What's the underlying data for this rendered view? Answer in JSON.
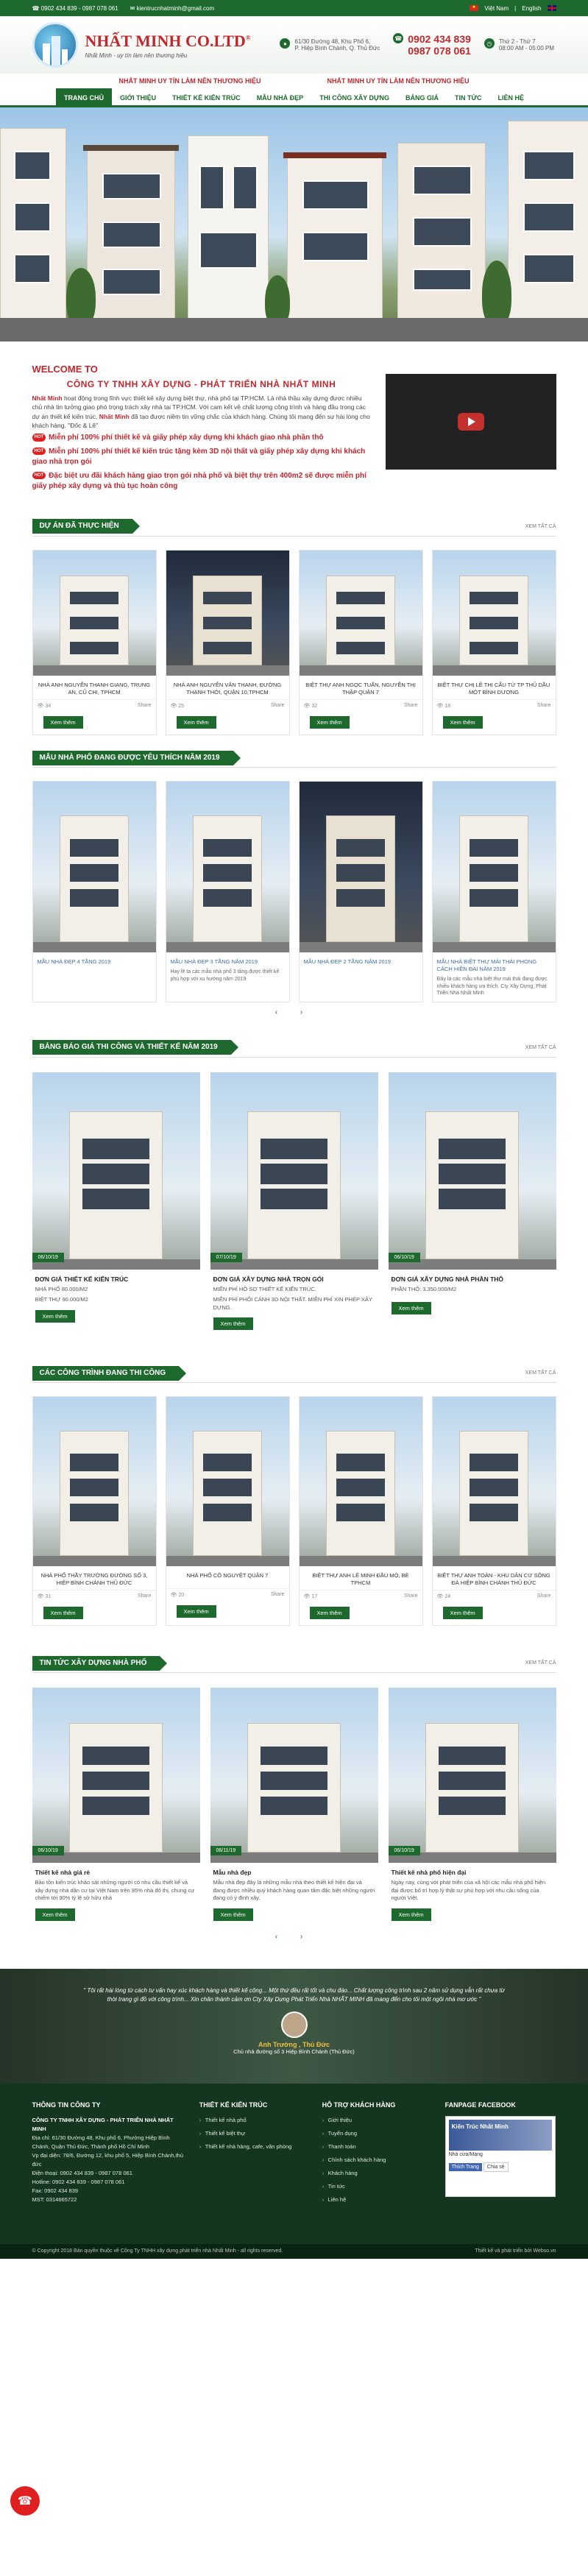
{
  "topbar": {
    "phone": "0902 434 839 - 0987 078 061",
    "email": "kientrucnhatminh@gmail.com",
    "lang_vn": "Việt Nam",
    "lang_en": "English"
  },
  "header": {
    "brand": "NHẤT MINH CO.LTD",
    "reg": "®",
    "slogan": "Nhất Minh - uy tín làm nên thương hiệu",
    "addr1": "61/30 Đường 48, Khu Phố 6,",
    "addr2": "P. Hiệp Bình Chánh, Q. Thủ Đức",
    "phone1": "0902 434 839",
    "phone2": "0987 078 061",
    "hours1": "Thứ 2 - Thứ 7",
    "hours2": "08:00 AM - 05:00 PM"
  },
  "marquee": [
    "NHẤT MINH UY TÍN LÀM NÊN THƯƠNG HIỆU",
    "NHẤT MINH UY TÍN LÀM NÊN THƯƠNG HIỆU"
  ],
  "nav": [
    "TRANG CHỦ",
    "GIỚI THIỆU",
    "THIẾT KẾ KIẾN TRÚC",
    "MẪU NHÀ ĐẸP",
    "THI CÔNG XÂY DỰNG",
    "BẢNG GIÁ",
    "TIN TỨC",
    "LIÊN HỆ"
  ],
  "welcome": {
    "title": "WELCOME TO",
    "company": "CÔNG TY TNHH XÂY DỰNG - PHÁT TRIỂN NHÀ NHẤT MINH",
    "p1a": "Nhất Minh",
    "p1b": " hoạt động trong lĩnh vực thiết kế xây dựng biệt thự, nhà phố tại TP.HCM. Là nhà thầu xây dựng được nhiều chủ nhà tin tưởng giao phó trọng trách xây nhà tại TP.HCM. Với cam kết về chất lượng công trình và hàng đầu trong các dự án thiết kế kiến trúc, ",
    "p1c": "Nhất Minh",
    "p1d": " đã tạo được niềm tin vững chắc của khách hàng. Chúng tôi mang đến sự hài lòng cho khách hàng. \"Đốc & Lê\"",
    "hot": "HOT",
    "f1": "Miễn phí 100% phí thiết kế và giấy phép xây dựng khi khách giao nhà phần thô",
    "f2": "Miễn phí 100% phí thiết kế kiến trúc tặng kèm 3D nội thất và giấy phép xây dựng khi khách giao nhà trọn gói",
    "f3": "Đặc biệt ưu đãi khách hàng giao trọn gói nhà phố và biệt thự trên 400m2 sẽ được miễn phí giấy phép xây dựng và thủ tục hoàn công"
  },
  "sections": {
    "s1": {
      "title": "DỰ ÁN ĐÃ THỰC HIỆN",
      "more": "XEM TẤT CẢ"
    },
    "s2": {
      "title": "MẪU NHÀ PHỐ ĐANG ĐƯỢC YÊU THÍCH NĂM 2019"
    },
    "s3": {
      "title": "BẢNG BÁO GIÁ THI CÔNG VÀ THIẾT KẾ NĂM 2019",
      "more": "XEM TẤT CẢ"
    },
    "s4": {
      "title": "CÁC CÔNG TRÌNH ĐANG THI CÔNG",
      "more": "XEM TẤT CẢ"
    },
    "s5": {
      "title": "TIN TỨC XÂY DỰNG NHÀ PHỐ",
      "more": "XEM TẤT CẢ"
    }
  },
  "projects": [
    {
      "cap": "NHÀ ANH NGUYỄN THANH GIANG, TRUNG AN, CỦ CHI, TPHCM",
      "views": "34",
      "share": "Share",
      "btn": "Xem thêm"
    },
    {
      "cap": "NHÀ ANH NGUYỄN VĂN THANH, ĐƯỜNG THẠNH THỚI, QUẬN 10,TPHCM",
      "views": "25",
      "share": "Share",
      "btn": "Xem thêm"
    },
    {
      "cap": "BIỆT THỰ ANH NGỌC TUẤN, NGUYỄN THỊ THẬP QUẬN 7",
      "views": "32",
      "share": "Share",
      "btn": "Xem thêm"
    },
    {
      "cap": "BIỆT THỰ CHỊ LÊ THỊ CẨU TỪ TP THỦ DẦU MỘT BÌNH DƯƠNG",
      "views": "18",
      "share": "Share",
      "btn": "Xem thêm"
    }
  ],
  "designs": [
    {
      "cap": "MẪU NHÀ ĐẸP 4 TẦNG 2019",
      "desc": ""
    },
    {
      "cap": "MẪU NHÀ ĐẸP 3 TẦNG NĂM 2019",
      "desc": "Hay lẽ ta các mẫu nhà phố 3 tầng được thiết kế phù hợp với xu hướng năm 2019"
    },
    {
      "cap": "MẪU NHÀ ĐẸP 2 TẦNG NĂM 2019",
      "desc": ""
    },
    {
      "cap": "MẪU NHÀ BIỆT THỰ MÁI THÁI PHONG CÁCH HIỆN ĐẠI NĂM 2019",
      "desc": "Đây là các mẫu nhà biệt thự mái thái đang được nhiều khách hàng ưa thích. Cty Xây Dựng, Phát Triển Nhà Nhất Minh"
    }
  ],
  "pager": "‹ ›",
  "prices": [
    {
      "date": "06/10/19",
      "title": "ĐƠN GIÁ THIẾT KẾ KIẾN TRÚC",
      "l1": "NHÀ PHỐ 80.000/M2",
      "l2": "BIỆT THỰ 90.000/M2",
      "btn": "Xem thêm"
    },
    {
      "date": "07/10/19",
      "title": "ĐƠN GIÁ XÂY DỰNG NHÀ TRỌN GÓI",
      "l1": "MIỄN PHÍ HỒ SƠ THIẾT KẾ KIẾN TRÚC.",
      "l2": "MIỄN PHÍ PHỐI CẢNH 3D NỘI THẤT. MIỄN PHÍ XIN PHÉP XÂY DỰNG.",
      "btn": "Xem thêm"
    },
    {
      "date": "06/10/19",
      "title": "ĐƠN GIÁ XÂY DỰNG NHÀ PHẦN THÔ",
      "l1": "PHẦN THÔ: 3.350.000/M2",
      "l2": "",
      "btn": "Xem thêm"
    }
  ],
  "construct": [
    {
      "cap": "NHÀ PHỐ THẦY TRƯỜNG ĐƯỜNG SỐ 3, HIỆP BÌNH CHÁNH THỦ ĐỨC",
      "views": "31",
      "share": "Share",
      "btn": "Xem thêm"
    },
    {
      "cap": "NHÀ PHỐ CÔ NGUYỆT QUẬN 7",
      "views": "20",
      "share": "Share",
      "btn": "Xem thêm"
    },
    {
      "cap": "BIỆT THỰ ANH LÊ MINH ĐẦU MỘ, BÈ TPHCM",
      "views": "17",
      "share": "Share",
      "btn": "Xem thêm"
    },
    {
      "cap": "BIỆT THỰ ANH TOÀN - KHU DÂN CƯ SÔNG ĐÀ HIỆP BÌNH CHÁNH THỦ ĐỨC",
      "views": "24",
      "share": "Share",
      "btn": "Xem thêm"
    }
  ],
  "news": [
    {
      "date": "06/10/19",
      "title": "Thiết kế nhà giá rẻ",
      "desc": "Bảo tồn kiến trúc khảo sát những người có nhu cầu thiết kế và xây dựng nhà dân cư tại Việt Nam trên 95% nhà đô thị, chung cư chiếm tới 90% tỷ lệ sở hữu nhà",
      "btn": "Xem thêm"
    },
    {
      "date": "06/11/19",
      "title": "Mẫu nhà đẹp",
      "desc": "Mẫu nhà đẹp đây là những mẫu nhà theo thiết kế hiện đại và đang được nhiều quý khách hàng quan tâm đặc biệt những người đang có ý định xây.",
      "btn": "Xem thêm"
    },
    {
      "date": "06/10/19",
      "title": "Thiết kế nhà phố hiện đại",
      "desc": "Ngày nay, cùng với phát triển của xã hội các mẫu nhà phố hiện đại được bố trí hợp lý thật sự phù hợp với nhu cầu sống của người Việt.",
      "btn": "Xem thêm"
    }
  ],
  "testimonial": {
    "quote": "\" Tôi rất hài lòng từ cách tư vấn hay xúc khách hàng và thiết kế công... Một thứ đều rất tốt và chu đáo... Chất lượng công trình sau 2 năm sử dụng vẫn rất chưa từ thời trang gì đồ với công trình... Xin chân thành cảm ơn Cty Xây Dựng Phát Triển Nhà NHẤT MINH đã mang đến cho tôi một ngôi nhà mơ ước \"",
    "name": "Anh Trường , Thủ Đức",
    "role": "Chủ nhà đường số 3 Hiệp Bình Chánh (Thủ Đức)"
  },
  "footer": {
    "c1": {
      "h": "THÔNG TIN CÔNG TY",
      "name": "CÔNG TY TNHH XÂY DỰNG - PHÁT TRIỂN NHÀ NHẤT MINH",
      "addr": "Địa chỉ: 61/30 Đường 48, Khu phố 6, Phường Hiệp Bình Chánh, Quận Thủ Đức, Thành phố Hồ Chí Minh",
      "office": "Vp đại diện: 78/6, Đường 12, khu phố 5, Hiệp Bình Chánh,thủ đức",
      "phone": "Điện thoại: 0902 434 839 - 0987 078 061",
      "hotline": "Hotline: 0902 434 839 - 0987 078 061",
      "fax": "Fax: 0902 434 839",
      "mst": "MST: 0314665722"
    },
    "c2": {
      "h": "THIẾT KẾ KIẾN TRÚC",
      "items": [
        "Thiết kế nhà phố",
        "Thiết kế biệt thự",
        "Thiết kế nhà hàng, cafe, văn phòng"
      ]
    },
    "c3": {
      "h": "HỖ TRỢ KHÁCH HÀNG",
      "items": [
        "Giới thiệu",
        "Tuyển dụng",
        "Thanh toán",
        "Chính sách khách hàng",
        "Khách hàng",
        "Tin tức",
        "Liên hệ"
      ]
    },
    "c4": {
      "h": "FANPAGE FACEBOOK",
      "fbname": "Kiến Trúc Nhất Minh",
      "fbmeta": "Nhà cửa/Mạng",
      "like": "Thích Trang",
      "share": "Chia sẻ"
    }
  },
  "copyright": {
    "left": "© Copyright 2018 Bản quyền thuộc về Công Ty TNHH xây dựng phát triển nhà Nhất Minh - all rights reserved.",
    "right": "Thiết kế và phát triển bởi Webso.vn"
  }
}
